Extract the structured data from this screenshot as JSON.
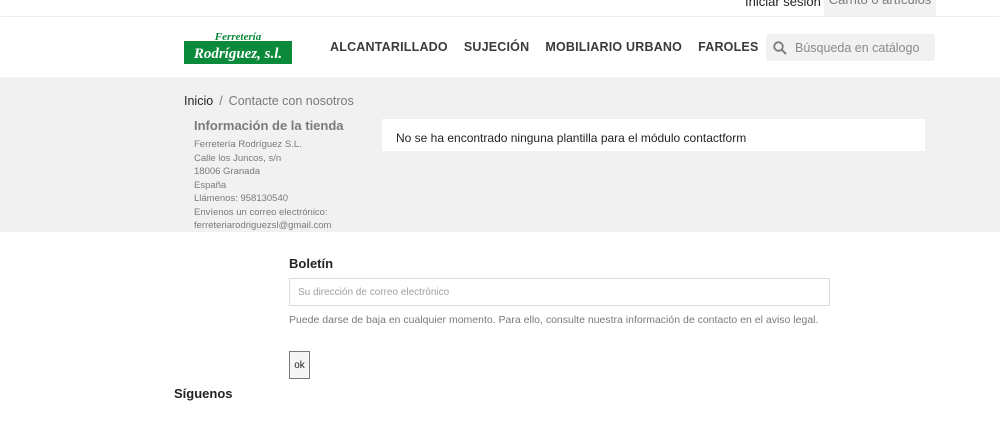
{
  "topbar": {
    "login_label": "Iniciar sesión",
    "cart_label": "Carrito 0 artículos"
  },
  "header": {
    "logo_line1": "Ferretería",
    "logo_line2": "Rodríguez, s.l.",
    "nav": [
      {
        "label": "ALCANTARILLADO"
      },
      {
        "label": "SUJECIÓN"
      },
      {
        "label": "MOBILIARIO URBANO"
      },
      {
        "label": "FAROLES"
      }
    ],
    "search_placeholder": "Búsqueda en catálogo"
  },
  "breadcrumb": {
    "home": "Inicio",
    "separator": "/",
    "current": "Contacte con nosotros"
  },
  "store_info": {
    "title": "Información de la tienda",
    "lines": [
      "Ferretería Rodríguez S.L.",
      "Calle los Juncos, s/n",
      "18006 Granada",
      "España",
      "Llámenos: 958130540",
      "Envíenos un correo electrónico:",
      "ferreteriarodriguezsl@gmail.com"
    ]
  },
  "notice": "No se ha encontrado ninguna plantilla para el módulo contactform",
  "newsletter": {
    "title": "Boletín",
    "email_placeholder": "Su dirección de correo electrónico",
    "legal": "Puede darse de baja en cualquier momento. Para ello, consulte nuestra información de contacto en el aviso legal.",
    "button_label": "ok"
  },
  "follow_title": "Síguenos",
  "colors": {
    "logo_green": "#0a8a3a",
    "content_bg": "#f1f1f1",
    "text_muted": "#7a7a7a",
    "text_dark": "#232323"
  }
}
